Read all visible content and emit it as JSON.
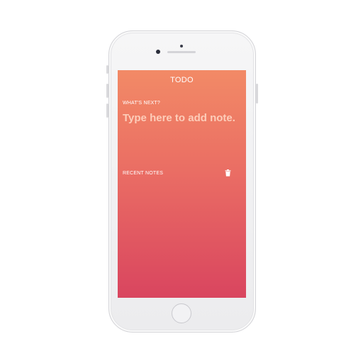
{
  "app": {
    "title": "TODO"
  },
  "compose": {
    "label": "WHAT'S NEXT?",
    "placeholder": "Type here to add note."
  },
  "recent": {
    "label": "RECENT NOTES",
    "clear_icon": "trash-icon"
  },
  "colors": {
    "gradient_top": "#f28a66",
    "gradient_bottom": "#d9455f",
    "text": "#ffffff"
  }
}
